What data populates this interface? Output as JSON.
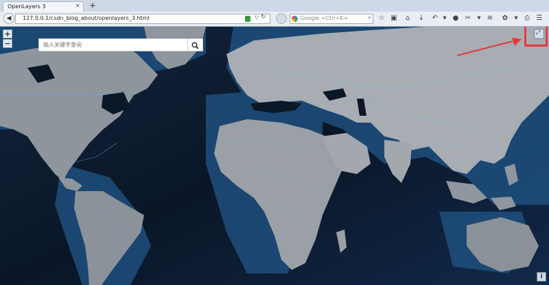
{
  "browser": {
    "tab_title": "OpenLayers 3",
    "url": "127.0.0.1/csdn_blog_about/openlayers_3.html",
    "search_placeholder": "Google <Ctrl+K>"
  },
  "map": {
    "zoom_in_label": "+",
    "zoom_out_label": "−",
    "search_placeholder": "输入关键字查询",
    "info_label": "i",
    "fullscreen_label": "⤢",
    "highlight_color": "#e33b3b"
  }
}
